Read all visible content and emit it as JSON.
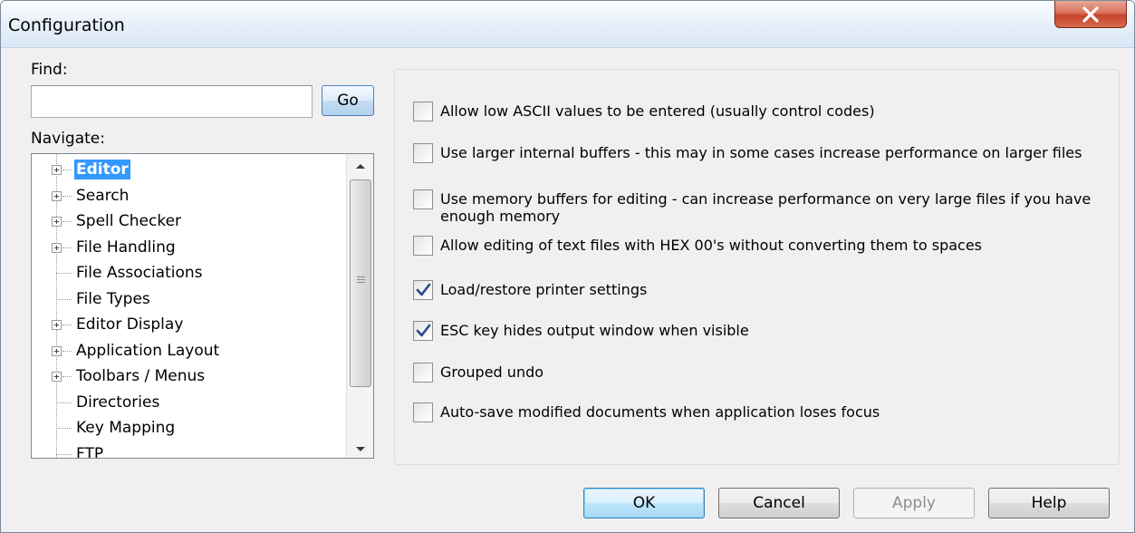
{
  "window": {
    "title": "Configuration",
    "close_icon": "close-x-icon"
  },
  "find": {
    "label": "Find:",
    "value": "",
    "go_label": "Go"
  },
  "navigate": {
    "label": "Navigate:",
    "items": [
      {
        "label": "Editor",
        "expandable": true,
        "selected": true
      },
      {
        "label": "Search",
        "expandable": true,
        "selected": false
      },
      {
        "label": "Spell Checker",
        "expandable": true,
        "selected": false
      },
      {
        "label": "File Handling",
        "expandable": true,
        "selected": false
      },
      {
        "label": "File Associations",
        "expandable": false,
        "selected": false
      },
      {
        "label": "File Types",
        "expandable": false,
        "selected": false
      },
      {
        "label": "Editor Display",
        "expandable": true,
        "selected": false
      },
      {
        "label": "Application Layout",
        "expandable": true,
        "selected": false
      },
      {
        "label": "Toolbars / Menus",
        "expandable": true,
        "selected": false
      },
      {
        "label": "Directories",
        "expandable": false,
        "selected": false
      },
      {
        "label": "Key Mapping",
        "expandable": false,
        "selected": false
      },
      {
        "label": "FTP",
        "expandable": false,
        "selected": false
      }
    ]
  },
  "options": [
    {
      "label": "Allow low ASCII values to be entered (usually control codes)",
      "checked": false
    },
    {
      "label": "Use larger internal buffers - this may in some cases increase performance on larger files",
      "checked": false
    },
    {
      "label": "Use memory buffers for editing - can increase performance on very large files if you have enough memory",
      "checked": false
    },
    {
      "label": "Allow editing of text files with HEX 00's without converting them to spaces",
      "checked": false
    },
    {
      "label": "Load/restore printer settings",
      "checked": true
    },
    {
      "label": "ESC key hides output window when visible",
      "checked": true
    },
    {
      "label": "Grouped undo",
      "checked": false
    },
    {
      "label": "Auto-save modified documents when application loses focus",
      "checked": false
    }
  ],
  "buttons": {
    "ok": "OK",
    "cancel": "Cancel",
    "apply": "Apply",
    "help": "Help"
  }
}
